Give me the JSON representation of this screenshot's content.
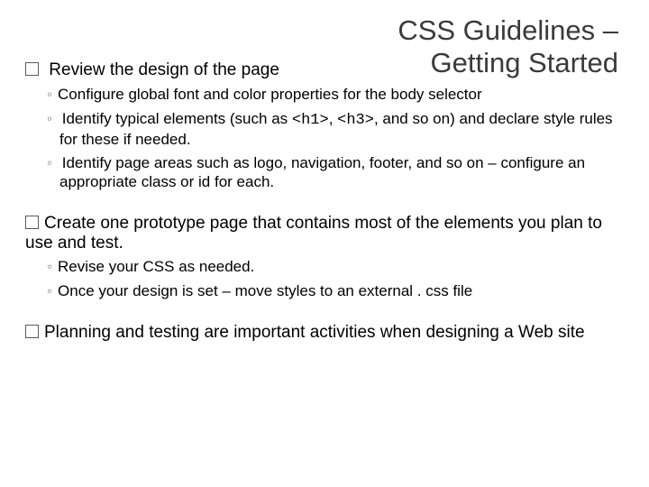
{
  "title_line1": "CSS Guidelines –",
  "title_line2": "Getting Started",
  "items": {
    "b1_before": "  Review the design of the page",
    "b1_s1": "Configure global font and color properties for the body selector",
    "b1_s2_a": " Identify typical elements (such as ",
    "b1_s2_code1": "<h1>",
    "b1_s2_mid": ", ",
    "b1_s2_code2": "<h3>",
    "b1_s2_b": ",  and so on) and declare style rules for these if needed.",
    "b1_s3": " Identify page areas such as logo, navigation, footer, and so on – configure an appropriate class or id for each.",
    "b2_a": "Create ",
    "b2_b": "one prototype page that contains most of the elements you plan to use and test.",
    "b2_s1": "Revise your CSS as needed.",
    "b2_s2": "Once your design is set – move styles to an external . css file",
    "b3_a": "Planning ",
    "b3_b": "and testing are  important activities when designing a Web site"
  }
}
